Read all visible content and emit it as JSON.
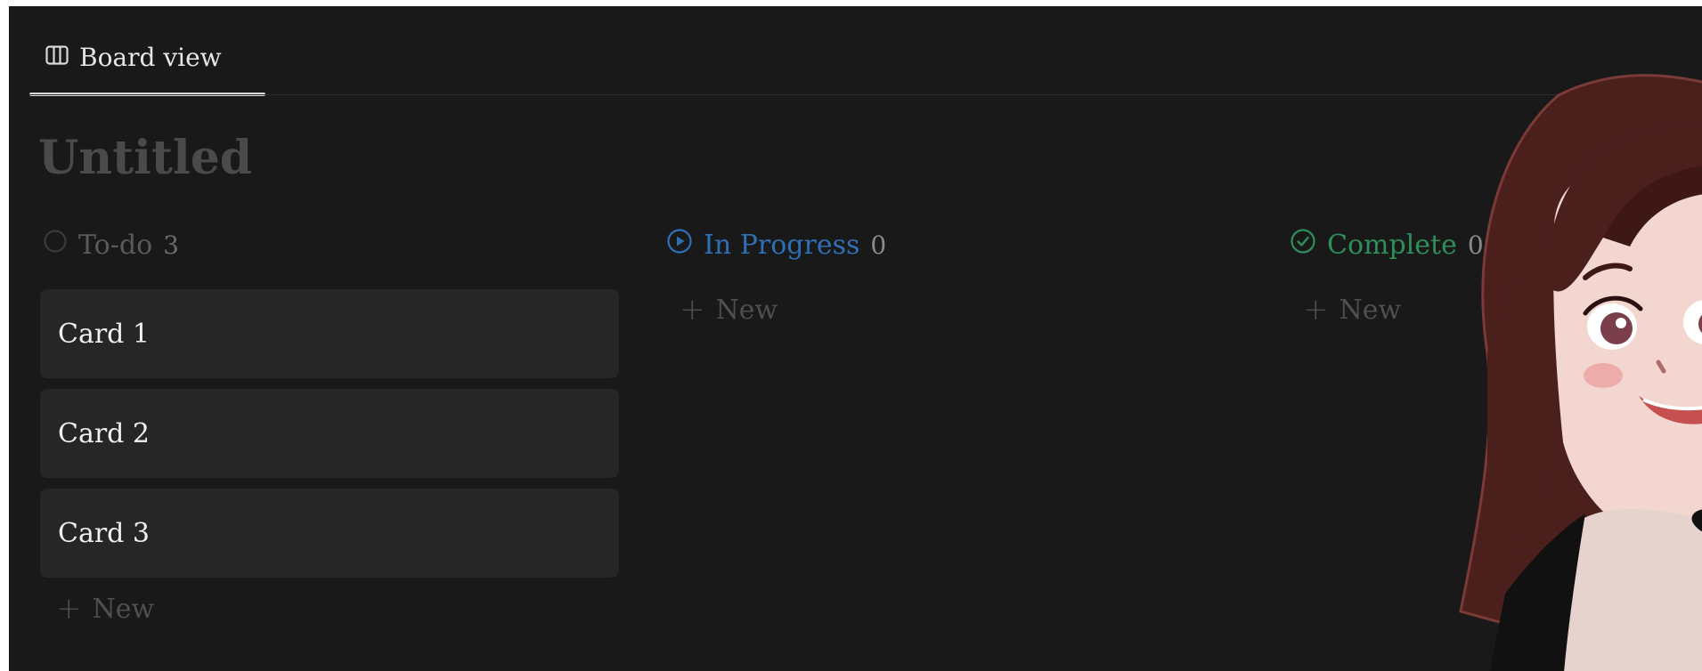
{
  "tabbar": {
    "active_tab": {
      "label": "Board view",
      "icon": "board-columns-icon"
    }
  },
  "page": {
    "title": "Untitled"
  },
  "board": {
    "columns": [
      {
        "name": "To-do",
        "count": "3",
        "icon": "empty-circle-icon",
        "color": "#5a5a5a",
        "count_color": "#6b6b6b",
        "cards": [
          {
            "title": "Card 1"
          },
          {
            "title": "Card 2"
          },
          {
            "title": "Card 3"
          }
        ],
        "new_label": "New"
      },
      {
        "name": "In Progress",
        "count": "0",
        "icon": "play-circle-icon",
        "color": "#2e6fb5",
        "count_color": "#8a8a8a",
        "cards": [],
        "new_label": "New"
      },
      {
        "name": "Complete",
        "count": "0",
        "icon": "check-circle-icon",
        "color": "#2f8f5b",
        "count_color": "#8a8a8a",
        "cards": [],
        "new_label": "New"
      }
    ]
  },
  "colors": {
    "background": "#191919",
    "card": "#262626",
    "title": "#4a4a4a",
    "muted": "#4f4f4f"
  },
  "overlay": {
    "icon": "cartoon-avatar-icon"
  }
}
